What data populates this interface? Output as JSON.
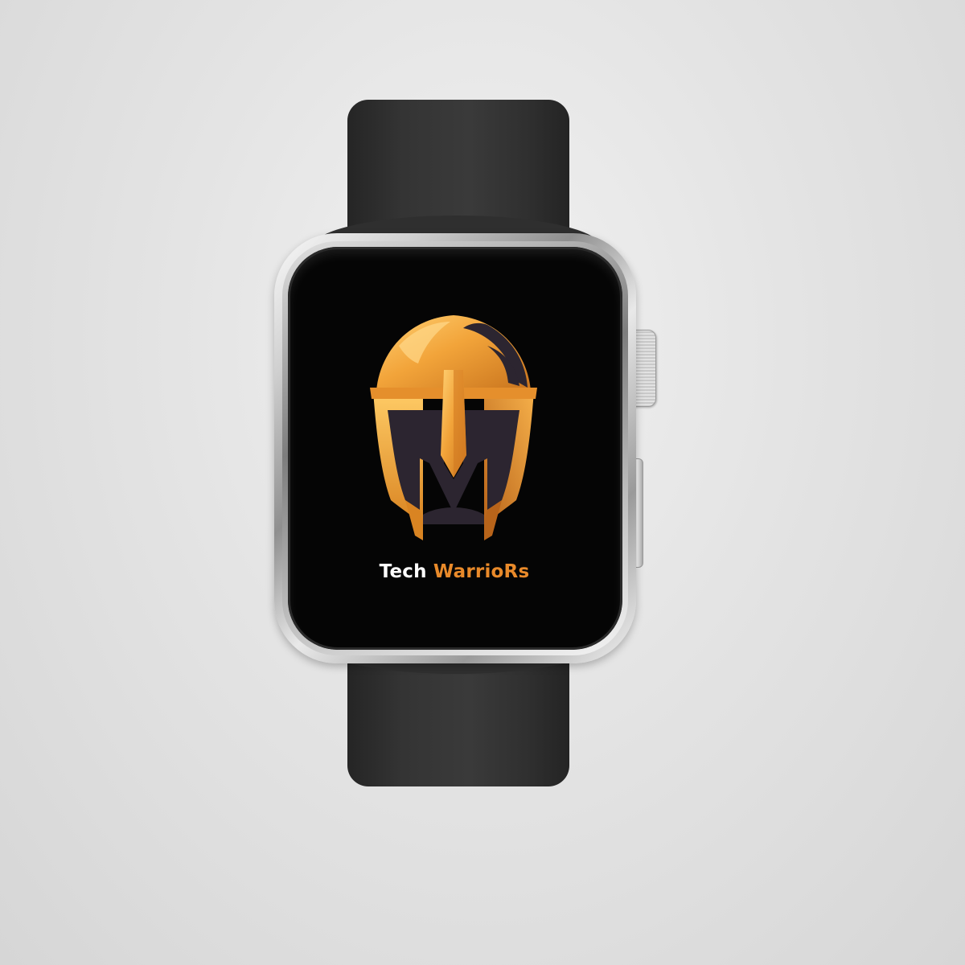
{
  "brand": {
    "word1": "Tech",
    "word2": "WarrioRs"
  },
  "logo_icon": "spartan-helmet-icon",
  "colors": {
    "background": "#e2e2e2",
    "band": "#333333",
    "screen": "#050505",
    "accent_orange": "#e98a2a",
    "helmet_gold": "#f2a43a",
    "helmet_dark": "#2c2530",
    "text_white": "#ffffff"
  }
}
